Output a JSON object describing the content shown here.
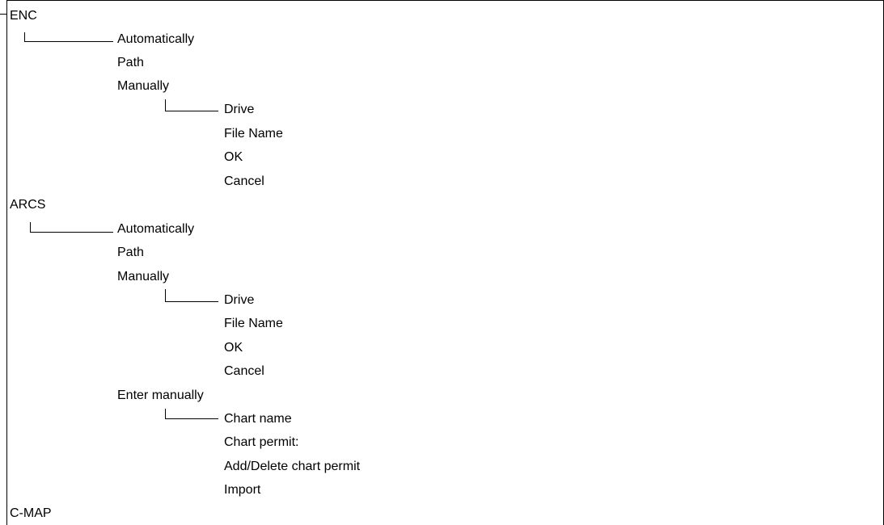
{
  "menu_tree": {
    "enc": {
      "label": "ENC",
      "items": [
        "Automatically",
        "Path",
        "Manually"
      ],
      "manually_items": [
        "Drive",
        "File Name",
        "OK",
        "Cancel"
      ]
    },
    "arcs": {
      "label": "ARCS",
      "items": [
        "Automatically",
        "Path",
        "Manually"
      ],
      "manually_items": [
        "Drive",
        "File Name",
        "OK",
        "Cancel"
      ],
      "enter_manually": {
        "label": "Enter manually",
        "items": [
          "Chart name",
          "Chart permit:",
          "Add/Delete chart permit",
          "Import"
        ]
      }
    },
    "cmap": {
      "label": "C-MAP"
    }
  }
}
